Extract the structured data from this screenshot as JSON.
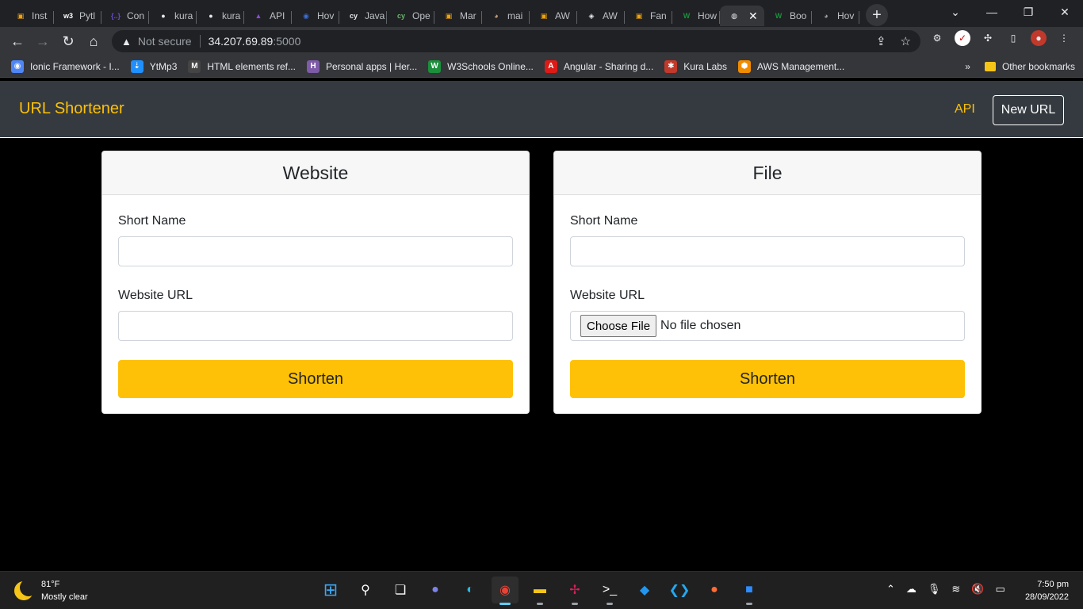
{
  "browser": {
    "tabs": [
      {
        "label": "Inst",
        "fav": "bag",
        "color": "#f0a30a"
      },
      {
        "label": "Pytl",
        "fav": "w3",
        "color": "#ffffff"
      },
      {
        "label": "Con",
        "fav": "{..}",
        "color": "#6b4bd7"
      },
      {
        "label": "kura",
        "fav": "gh",
        "color": "#e8eaed"
      },
      {
        "label": "kura",
        "fav": "gh",
        "color": "#e8eaed"
      },
      {
        "label": "API",
        "fav": "ap",
        "color": "#8a4bd7"
      },
      {
        "label": "Hov",
        "fav": "i",
        "color": "#3b6fd7"
      },
      {
        "label": "Java",
        "fav": "cy",
        "color": "#e8eaed"
      },
      {
        "label": "Ope",
        "fav": "cy",
        "color": "#67b86a"
      },
      {
        "label": "Mar",
        "fav": "bag",
        "color": "#f0a30a"
      },
      {
        "label": "mai",
        "fav": "av",
        "color": "#caa07a"
      },
      {
        "label": "AW",
        "fav": "bag",
        "color": "#f0a30a"
      },
      {
        "label": "AW",
        "fav": "aw",
        "color": "#e8eaed"
      },
      {
        "label": "Fan",
        "fav": "bag",
        "color": "#f0a30a"
      },
      {
        "label": "How",
        "fav": "W",
        "color": "#1c8f3c"
      },
      {
        "label": "",
        "fav": "globe",
        "color": "#e8eaed",
        "active": true
      },
      {
        "label": "Boo",
        "fav": "W",
        "color": "#1c8f3c"
      },
      {
        "label": "Hov",
        "fav": "av",
        "color": "#9aa0a6"
      }
    ],
    "close_tab_glyph": "✕",
    "new_tab_glyph": "+",
    "security_label": "Not secure",
    "url_host": "34.207.69.89",
    "url_port": ":5000",
    "bookmarks": [
      {
        "label": "Ionic Framework - I...",
        "color": "#4f86f7",
        "icon": "◉"
      },
      {
        "label": "YtMp3",
        "color": "#1e90ff",
        "icon": "⇣"
      },
      {
        "label": "HTML elements ref...",
        "color": "#444444",
        "icon": "M"
      },
      {
        "label": "Personal apps | Her...",
        "color": "#7d5ba6",
        "icon": "H"
      },
      {
        "label": "W3Schools Online...",
        "color": "#1c8f3c",
        "icon": "W"
      },
      {
        "label": "Angular - Sharing d...",
        "color": "#dd1b16",
        "icon": "A"
      },
      {
        "label": "Kura Labs",
        "color": "#c0392b",
        "icon": "✱"
      },
      {
        "label": "AWS Management...",
        "color": "#f08c00",
        "icon": "⬢"
      }
    ],
    "bookmarks_overflow": "»",
    "other_bookmarks": "Other bookmarks"
  },
  "app": {
    "brand": "URL Shortener",
    "api_link": "API",
    "new_url_button": "New URL"
  },
  "website_card": {
    "title": "Website",
    "short_name_label": "Short Name",
    "short_name_value": "",
    "url_label": "Website URL",
    "url_value": "",
    "submit_label": "Shorten"
  },
  "file_card": {
    "title": "File",
    "short_name_label": "Short Name",
    "short_name_value": "",
    "url_label": "Website URL",
    "choose_file_label": "Choose File",
    "file_status": "No file chosen",
    "submit_label": "Shorten"
  },
  "taskbar": {
    "temperature": "81°F",
    "weather": "Mostly clear",
    "time": "7:50 pm",
    "date": "28/09/2022"
  },
  "colors": {
    "accent": "#ffc107",
    "navbar": "#343a40",
    "page_bg": "#000000"
  }
}
